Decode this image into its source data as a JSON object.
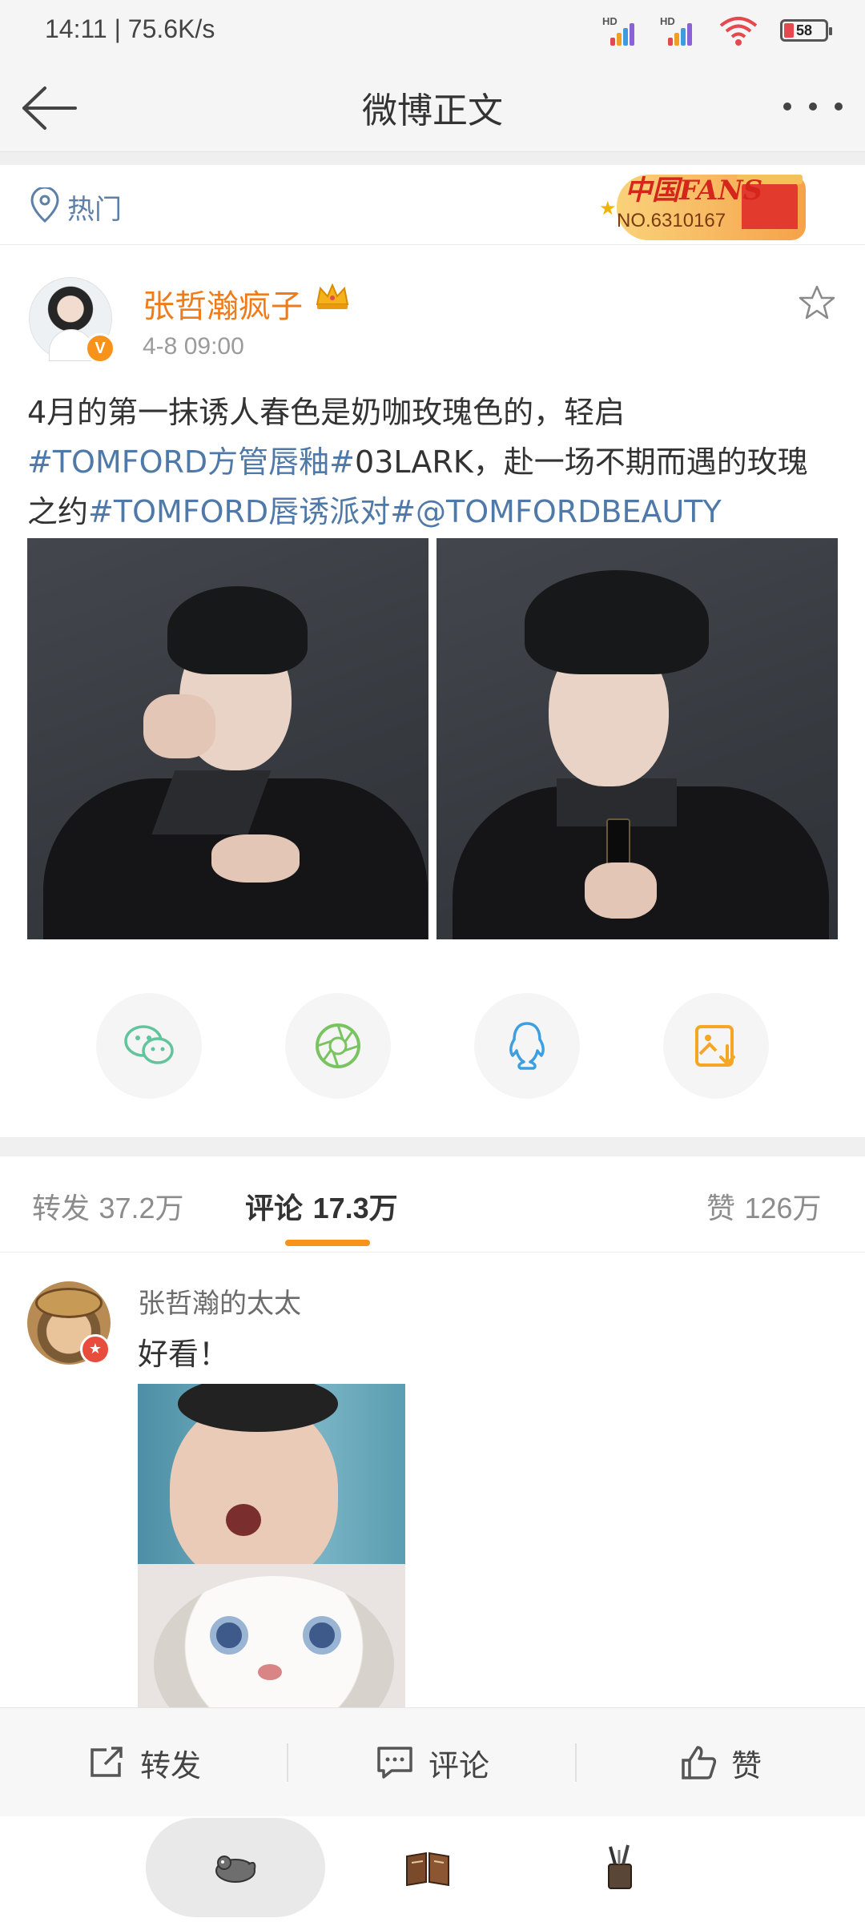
{
  "status_bar": {
    "time_speed": "14:11 | 75.6K/s",
    "signal_1": "HD",
    "signal_2": "HD",
    "battery": "58"
  },
  "header": {
    "title": "微博正文",
    "back_icon": "arrow-left-icon",
    "more_icon": "more-dots-icon"
  },
  "hot": {
    "label": "热门",
    "icon": "hot-location-icon"
  },
  "fans_badge": {
    "title": "中国FANS",
    "number": "NO.6310167"
  },
  "post": {
    "author": "张哲瀚疯子",
    "time": "4-8 09:00",
    "text_plain_1": "4月的第一抹诱人春色是奶咖玫瑰色的，轻启",
    "tag_1": "#TOMFORD方管唇釉#",
    "text_plain_2": "03LARK，赴一场不期而遇的玫瑰之约",
    "tag_2": "#TOMFORD唇诱派对#",
    "mention": "@TOMFORDBEAUTY",
    "favorite_icon": "star-outline-icon"
  },
  "share_targets": [
    "wechat-icon",
    "moments-icon",
    "qq-icon",
    "save-image-icon"
  ],
  "tabs": {
    "repost_label": "转发",
    "repost_count": "37.2万",
    "comment_label": "评论",
    "comment_count": "17.3万",
    "like_label": "赞",
    "like_count": "126万"
  },
  "comment": {
    "name": "张哲瀚的太太",
    "text": "好看！"
  },
  "actions": {
    "repost": "转发",
    "comment": "评论",
    "like": "赞"
  },
  "dock": [
    "pet-icon",
    "book-icon",
    "pen-cup-icon"
  ],
  "colors": {
    "accent": "#f7931a",
    "author": "#f07b18",
    "link": "#4f79a8",
    "wechat": "#62c49c",
    "moments": "#79c461",
    "qq": "#3d9fe0",
    "save": "#f5a623"
  }
}
